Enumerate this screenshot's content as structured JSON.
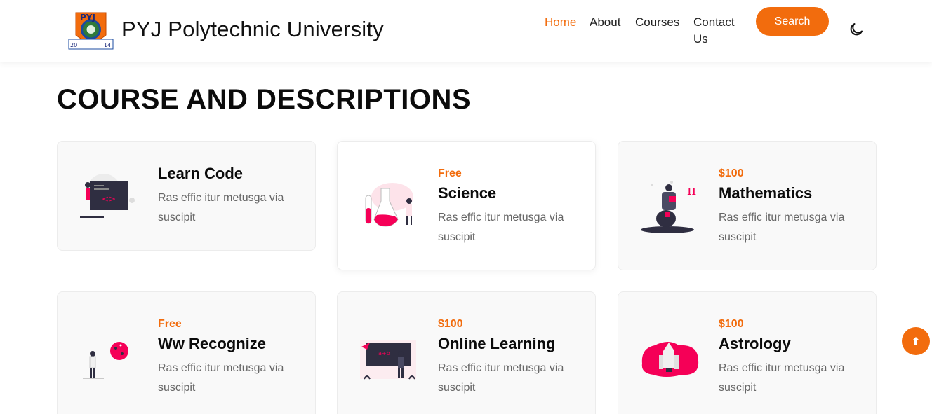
{
  "header": {
    "logo_text_top": "PYJ",
    "logo_year_left": "20",
    "logo_year_right": "14",
    "brand": "PYJ Polytechnic University",
    "nav": {
      "home": "Home",
      "about": "About",
      "courses": "Courses",
      "contact": "Contact Us"
    },
    "search_label": "Search",
    "accent_color": "#f26c0d"
  },
  "main": {
    "title": "COURSE AND DESCRIPTIONS",
    "courses": [
      {
        "price": "",
        "title": "Learn Code",
        "description": "Ras effic itur metusga via suscipit",
        "icon": "code-board-illustration"
      },
      {
        "price": "Free",
        "title": "Science",
        "description": "Ras effic itur metusga via suscipit",
        "icon": "flask-illustration"
      },
      {
        "price": "$100",
        "title": "Mathematics",
        "description": "Ras effic itur metusga via suscipit",
        "icon": "pi-reader-illustration"
      },
      {
        "price": "Free",
        "title": "Ww Recognize",
        "description": "Ras effic itur metusga via suscipit",
        "icon": "globe-person-illustration"
      },
      {
        "price": "$100",
        "title": "Online Learning",
        "description": "Ras effic itur metusga via suscipit",
        "icon": "chalkboard-teacher-illustration"
      },
      {
        "price": "$100",
        "title": "Astrology",
        "description": "Ras effic itur metusga via suscipit",
        "icon": "rocket-illustration"
      }
    ]
  },
  "scroll_top_icon": "arrow-up-icon"
}
